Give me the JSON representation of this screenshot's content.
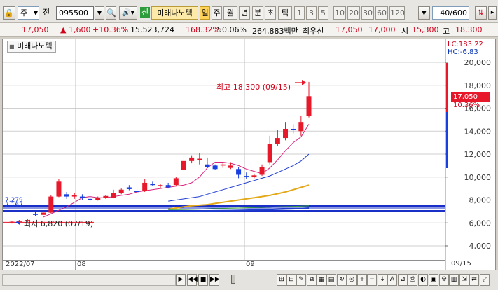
{
  "toolbar": {
    "market": "주",
    "exchange_label": "전",
    "stock_code": "095500",
    "badge_new": "신",
    "stock_name": "미래나노텍",
    "periods": [
      "일",
      "주",
      "월",
      "년",
      "분",
      "초",
      "틱"
    ],
    "intervals": [
      "1",
      "3",
      "5",
      "10",
      "20",
      "30",
      "60",
      "120"
    ],
    "count_value": "40",
    "count_total": "/600"
  },
  "info_bar": {
    "price": "17,050",
    "change": "▲   1,600",
    "change_pct": "+10.36%",
    "volume": "15,523,724",
    "volume_ratio": "168.32%",
    "rotation": "50.06%",
    "amount": "264,883백만",
    "best_offer_label": "최우선",
    "ask": "17,050",
    "bid": "17,000",
    "open_label": "시",
    "open": "15,300",
    "high_label": "고",
    "high": "18,300"
  },
  "chart": {
    "title": "미래나노텍",
    "lc": "LC:183.22",
    "hc": "HC:-6.83",
    "y_ticks": [
      "20,000",
      "18,000",
      "16,000",
      "14,000",
      "12,000",
      "10,000",
      "8,000",
      "6,000",
      "4,000"
    ],
    "price_tag": "17,050",
    "price_tag_pct": "10.36%",
    "max_annotation": "최고 18,300 (09/15)",
    "min_annotation": "최저 6,820 (07/19)",
    "ma_value_1": "7,279",
    "ma_value_2": "7,167",
    "x_labels": [
      "2022/07",
      "08",
      "09"
    ],
    "last_date": "09/15",
    "colors": {
      "up": "#e8182b",
      "down": "#1a3fe0",
      "ma5": "#d9237e",
      "ma20": "#1e3dd1",
      "ma60": "#e3a91b",
      "ma120": "#3aa13a"
    }
  },
  "chart_data": {
    "type": "candlestick",
    "title": "미래나노텍",
    "x_range": [
      "2022/07",
      "09/15"
    ],
    "ylim": [
      4000,
      20000
    ],
    "candles": [
      {
        "o": 6050,
        "h": 6200,
        "l": 5950,
        "c": 6100
      },
      {
        "o": 6100,
        "h": 6250,
        "l": 6000,
        "c": 6150
      },
      {
        "o": 6150,
        "h": 6350,
        "l": 6050,
        "c": 6250
      },
      {
        "o": 6800,
        "h": 7000,
        "l": 6600,
        "c": 6700
      },
      {
        "o": 6700,
        "h": 7100,
        "l": 6820,
        "c": 6900
      },
      {
        "o": 6900,
        "h": 8400,
        "l": 6850,
        "c": 8300
      },
      {
        "o": 8300,
        "h": 9800,
        "l": 8250,
        "c": 9600
      },
      {
        "o": 8500,
        "h": 8700,
        "l": 8100,
        "c": 8300
      },
      {
        "o": 8300,
        "h": 8600,
        "l": 8100,
        "c": 8400
      },
      {
        "o": 8300,
        "h": 8500,
        "l": 8000,
        "c": 8200
      },
      {
        "o": 8100,
        "h": 8300,
        "l": 7900,
        "c": 8000
      },
      {
        "o": 8000,
        "h": 8300,
        "l": 7950,
        "c": 8200
      },
      {
        "o": 8200,
        "h": 8450,
        "l": 8100,
        "c": 8350
      },
      {
        "o": 8200,
        "h": 8900,
        "l": 8150,
        "c": 8600
      },
      {
        "o": 8600,
        "h": 9000,
        "l": 8500,
        "c": 8900
      },
      {
        "o": 9100,
        "h": 9300,
        "l": 8850,
        "c": 8950
      },
      {
        "o": 8800,
        "h": 9000,
        "l": 8600,
        "c": 8700
      },
      {
        "o": 8800,
        "h": 9800,
        "l": 8700,
        "c": 9500
      },
      {
        "o": 9400,
        "h": 9600,
        "l": 9200,
        "c": 9300
      },
      {
        "o": 9200,
        "h": 9400,
        "l": 9000,
        "c": 9300
      },
      {
        "o": 9300,
        "h": 9500,
        "l": 9000,
        "c": 9100
      },
      {
        "o": 9300,
        "h": 10000,
        "l": 9200,
        "c": 9900
      },
      {
        "o": 10600,
        "h": 11800,
        "l": 10500,
        "c": 11400
      },
      {
        "o": 11400,
        "h": 11900,
        "l": 11200,
        "c": 11700
      },
      {
        "o": 11500,
        "h": 12100,
        "l": 11100,
        "c": 11600
      },
      {
        "o": 11100,
        "h": 11700,
        "l": 10800,
        "c": 10900
      },
      {
        "o": 11000,
        "h": 11100,
        "l": 10600,
        "c": 10700
      },
      {
        "o": 11000,
        "h": 11300,
        "l": 10800,
        "c": 11100
      },
      {
        "o": 10800,
        "h": 11300,
        "l": 10700,
        "c": 11000
      },
      {
        "o": 10700,
        "h": 10900,
        "l": 9900,
        "c": 10200
      },
      {
        "o": 10100,
        "h": 10400,
        "l": 9800,
        "c": 10000
      },
      {
        "o": 10000,
        "h": 10300,
        "l": 9900,
        "c": 10150
      },
      {
        "o": 10200,
        "h": 11100,
        "l": 10100,
        "c": 10900
      },
      {
        "o": 11300,
        "h": 13600,
        "l": 11100,
        "c": 12900
      },
      {
        "o": 12900,
        "h": 14100,
        "l": 12700,
        "c": 13400
      },
      {
        "o": 13400,
        "h": 14800,
        "l": 13200,
        "c": 14200
      },
      {
        "o": 14200,
        "h": 14600,
        "l": 13800,
        "c": 14100
      },
      {
        "o": 14000,
        "h": 15300,
        "l": 13600,
        "c": 14800
      },
      {
        "o": 15300,
        "h": 18300,
        "l": 15200,
        "c": 17050
      }
    ],
    "series": [
      {
        "values": [
          null,
          null,
          null,
          null,
          6500,
          6800,
          7100,
          7400,
          7800,
          8200,
          8300,
          8200,
          8200,
          8300,
          8400,
          8500,
          8700,
          8800,
          8900,
          9000,
          9100,
          9200,
          9300,
          9500,
          10000,
          10800,
          11300,
          11300,
          11200,
          11000,
          10700,
          10500,
          10300,
          10800,
          11500,
          12300,
          13000,
          13500,
          14600
        ]
      },
      {
        "values": [
          null,
          null,
          null,
          null,
          null,
          null,
          null,
          null,
          null,
          null,
          null,
          null,
          null,
          null,
          null,
          null,
          null,
          null,
          null,
          null,
          7900,
          8000,
          8100,
          8200,
          8300,
          8500,
          8700,
          8900,
          9100,
          9300,
          9500,
          9700,
          9900,
          10100,
          10400,
          10700,
          11000,
          11400,
          12000
        ]
      },
      {
        "values": [
          null,
          null,
          null,
          null,
          null,
          null,
          null,
          null,
          null,
          null,
          null,
          null,
          null,
          null,
          null,
          null,
          null,
          null,
          null,
          null,
          7200,
          7300,
          7400,
          7500,
          7550,
          7600,
          7700,
          7800,
          7900,
          8000,
          8100,
          8200,
          8300,
          8400,
          8550,
          8700,
          8900,
          9100,
          9300
        ]
      },
      {
        "values": [
          null,
          null,
          null,
          null,
          null,
          null,
          null,
          null,
          null,
          null,
          null,
          null,
          null,
          null,
          null,
          null,
          null,
          null,
          null,
          null,
          7150,
          7160,
          7170,
          7180,
          7200,
          7220,
          7240,
          7260,
          7280,
          7300,
          7320,
          7340,
          7360,
          7380,
          7400,
          7420,
          7440,
          7470,
          7500
        ]
      },
      {
        "values": [
          null,
          null,
          null,
          null,
          null,
          null,
          null,
          null,
          null,
          null,
          null,
          null,
          null,
          null,
          null,
          null,
          null,
          null,
          null,
          null,
          7000,
          7010,
          7020,
          7030,
          7040,
          7050,
          7060,
          7070,
          7080,
          7090,
          7110,
          7130,
          7150,
          7170,
          7190,
          7210,
          7230,
          7260,
          7300
        ]
      }
    ]
  }
}
